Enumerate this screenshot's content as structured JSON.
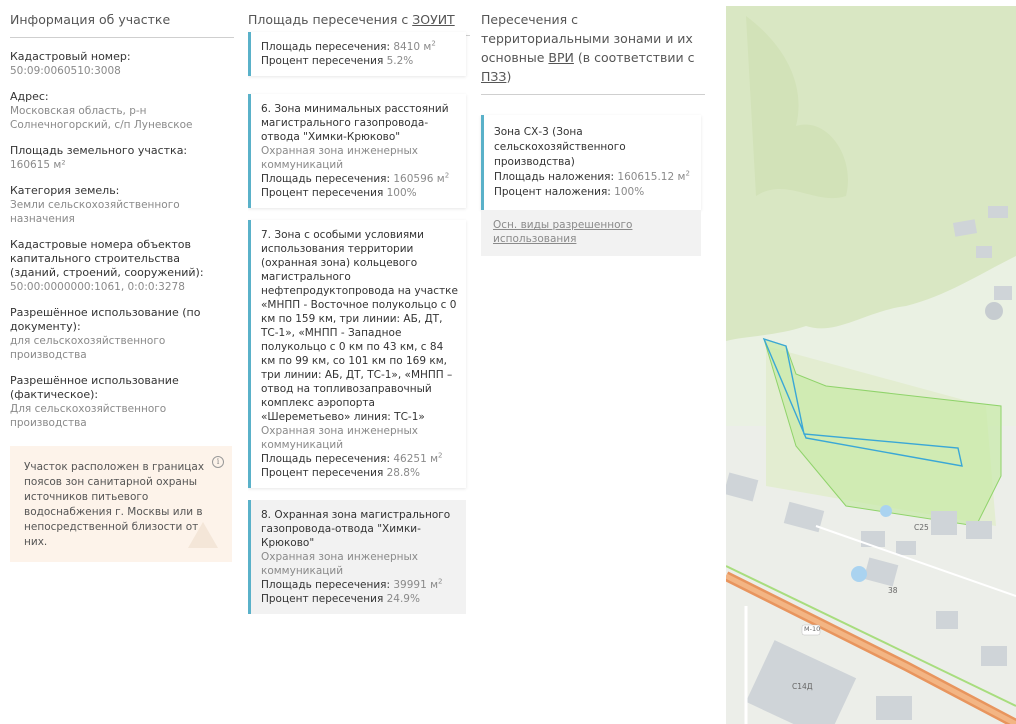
{
  "parcel_info": {
    "title": "Информация об участке",
    "fields": [
      {
        "label": "Кадастровый номер:",
        "value": "50:09:0060510:3008"
      },
      {
        "label": "Адрес:",
        "value": "Московская область, р-н Солнечногорский, с/п Луневское"
      },
      {
        "label": "Площадь земельного участка:",
        "value": "160615 м²"
      },
      {
        "label": "Категория земель:",
        "value": "Земли сельскохозяйственного назначения"
      },
      {
        "label": "Кадастровые номера объектов капитального строительства (зданий, строений, сооружений):",
        "value": "50:00:0000000:1061, 0:0:0:3278"
      },
      {
        "label": "Разрешённое использование (по документу):",
        "value": "для сельскохозяйственного производства"
      },
      {
        "label": "Разрешённое использование (фактическое):",
        "value": "Для сельскохозяйственного производства"
      }
    ],
    "notice": "Участок расположен в границах поясов зон санитарной охраны источников питьевого водоснабжения г. Москвы или в непосредственной близости от них.",
    "notice_icon": "info-icon"
  },
  "intersection": {
    "title_prefix": "Площадь пересечения с ",
    "title_abbr": "ЗОУИТ",
    "cards": [
      {
        "title": "",
        "subtitle": "",
        "area_label": "Площадь пересечения:",
        "area_value": "8410 м",
        "area_sup": "2",
        "pct_label": "Процент пересечения",
        "pct_value": "5.2%",
        "grey": false
      },
      {
        "title": "6. Зона минимальных расстояний магистрального газопровода-отвода \"Химки-Крюково\"",
        "subtitle": "Охранная зона инженерных коммуникаций",
        "area_label": "Площадь пересечения:",
        "area_value": "160596 м",
        "area_sup": "2",
        "pct_label": "Процент пересечения",
        "pct_value": "100%",
        "grey": false
      },
      {
        "title": "7. Зона с особыми условиями использования территории (охранная зона) кольцевого магистрального нефтепродуктопровода на участке «МНПП - Восточное полукольцо с 0 км по 159 км, три линии: АБ, ДТ, ТС-1», «МНПП - Западное полукольцо с 0 км по 43 км, с 84 км по 99 км, со 101 км по 169 км, три линии: АБ, ДТ, ТС-1», «МНПП – отвод на топливозаправочный комплекс аэропорта «Шереметьево» линия: ТС-1»",
        "subtitle": "Охранная зона инженерных коммуникаций",
        "area_label": "Площадь пересечения:",
        "area_value": "46251 м",
        "area_sup": "2",
        "pct_label": "Процент пересечения",
        "pct_value": "28.8%",
        "grey": false
      },
      {
        "title": "8. Охранная зона магистрального газопровода-отвода \"Химки-Крюково\"",
        "subtitle": "Охранная зона инженерных коммуникаций",
        "area_label": "Площадь пересечения:",
        "area_value": "39991 м",
        "area_sup": "2",
        "pct_label": "Процент пересечения",
        "pct_value": "24.9%",
        "grey": true
      }
    ]
  },
  "zones": {
    "title_part1": "Пересечения с территориальными зонами и их основные ",
    "title_abbr1": "ВРИ",
    "title_part2": " (в соответствии с ",
    "title_abbr2": "ПЗЗ",
    "title_part3": ")",
    "card": {
      "name": "Зона СХ-3 (Зона сельскохозяйственного производства)",
      "area_label": "Площадь наложения:",
      "area_value": "160615.12 м",
      "area_sup": "2",
      "pct_label": "Процент наложения:",
      "pct_value": "100%"
    },
    "link": "Осн. виды разрешенного использования"
  },
  "map": {
    "labels": [
      "С25",
      "38",
      "М-10",
      "С14Д"
    ],
    "colors": {
      "forest": "#dbe8c8",
      "field": "#e4eecf",
      "highway": "#e8955e",
      "parcel": "#3aa7d6",
      "zone": "#a8dd7e",
      "building": "#cfd4d8",
      "water": "#aad3f0"
    }
  }
}
